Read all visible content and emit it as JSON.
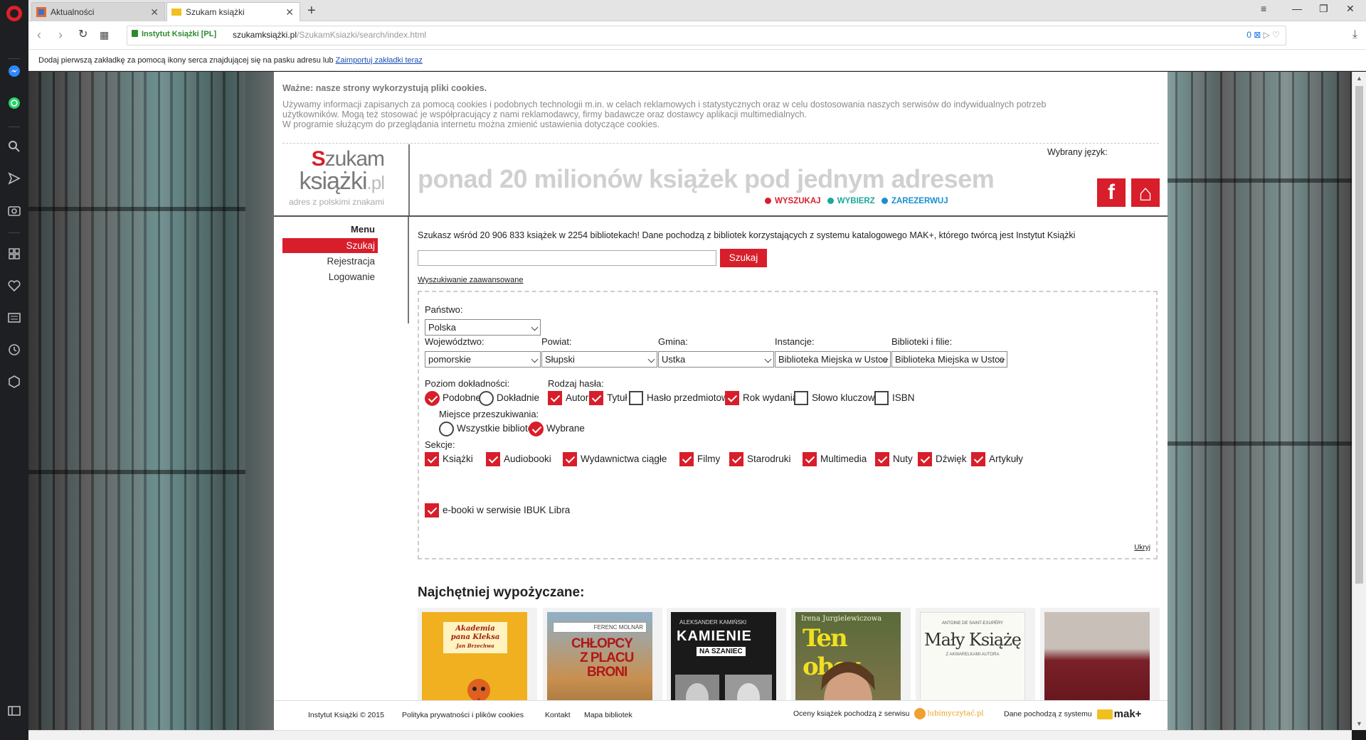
{
  "browser": {
    "tabs": [
      {
        "label": "Aktualności",
        "active": false
      },
      {
        "label": "Szukam książki",
        "active": true
      }
    ],
    "security_label": "Instytut Książki [PL]",
    "url_host": "szukamksiążki.pl",
    "url_path": "/SzukamKsiazki/search/index.html",
    "url_badge": "0",
    "bookmark_notice": "Dodaj pierwszą zakładkę za pomocą ikony serca znajdującej się na pasku adresu lub",
    "bookmark_link": "Zaimportuj zakładki teraz"
  },
  "cookie": {
    "title": "Ważne: nasze strony wykorzystują pliki cookies.",
    "line1": "Używamy informacji zapisanych za pomocą cookies i podobnych technologii m.in. w celach reklamowych i statystycznych oraz w celu dostosowania naszych serwisów do indywidualnych potrzeb",
    "line2": "użytkowników. Mogą też stosować je współpracujący z nami reklamodawcy, firmy badawcze oraz dostawcy aplikacji multimedialnych.",
    "line3": "W programie służącym do przeglądania internetu można zmienić ustawienia dotyczące cookies."
  },
  "header": {
    "logo_line1": "zukam",
    "logo_q": "S",
    "logo_line2": "książki",
    "logo_pl": ".pl",
    "logo_tagline": "adres z polskimi znakami",
    "slogan": "ponad 20 milionów książek pod jednym adresem",
    "steps": [
      {
        "label": "WYSZUKAJ",
        "color": "#d81e2a"
      },
      {
        "label": "WYBIERZ",
        "color": "#1aa89a"
      },
      {
        "label": "ZAREZERWUJ",
        "color": "#1a8fd0"
      }
    ],
    "language_label": "Wybrany język:",
    "facebook_glyph": "f",
    "home_glyph": "⌂"
  },
  "menu": {
    "title": "Menu",
    "items": [
      "Szukaj",
      "Rejestracja",
      "Logowanie"
    ]
  },
  "search": {
    "intro": "Szukasz wśród 20 906 833 książek w 2254 bibliotekach! Dane pochodzą z bibliotek korzystających z systemu katalogowego MAK+, którego twórcą jest Instytut Książki",
    "input_value": "",
    "button": "Szukaj",
    "advanced_link": "Wyszukiwanie zaawansowane"
  },
  "filters": {
    "country_label": "Państwo:",
    "country_value": "Polska",
    "region_labels": [
      "Województwo:",
      "Powiat:",
      "Gmina:",
      "Instancje:",
      "Biblioteki i filie:"
    ],
    "region_values": [
      "pomorskie",
      "Słupski",
      "Ustka",
      "Biblioteka Miejska w Ustce",
      "Biblioteka Miejska w Ustce"
    ],
    "precision_label": "Poziom dokładności:",
    "precision_options": [
      {
        "label": "Podobne",
        "checked": true
      },
      {
        "label": "Dokładnie",
        "checked": false
      }
    ],
    "term_label": "Rodzaj hasła:",
    "term_options": [
      {
        "label": "Autor",
        "checked": true
      },
      {
        "label": "Tytuł",
        "checked": true
      },
      {
        "label": "Hasło przedmiotowe",
        "checked": false
      },
      {
        "label": "Rok wydania",
        "checked": true
      },
      {
        "label": "Słowo kluczowe",
        "checked": false
      },
      {
        "label": "ISBN",
        "checked": false
      }
    ],
    "place_label": "Miejsce przeszukiwania:",
    "place_options": [
      {
        "label": "Wszystkie biblioteki",
        "checked": false
      },
      {
        "label": "Wybrane",
        "checked": true
      }
    ],
    "sections_label": "Sekcje:",
    "sections": [
      {
        "label": "Książki",
        "checked": true
      },
      {
        "label": "Audiobooki",
        "checked": true
      },
      {
        "label": "Wydawnictwa ciągłe",
        "checked": true
      },
      {
        "label": "Filmy",
        "checked": true
      },
      {
        "label": "Starodruki",
        "checked": true
      },
      {
        "label": "Multimedia",
        "checked": true
      },
      {
        "label": "Nuty",
        "checked": true
      },
      {
        "label": "Dźwięk",
        "checked": true
      },
      {
        "label": "Artykuły",
        "checked": true
      }
    ],
    "ebook_option": {
      "label": "e-booki w serwisie IBUK Libra",
      "checked": true
    },
    "hide_link": "Ukryj"
  },
  "popular": {
    "title": "Najchętniej wypożyczane:",
    "covers": [
      {
        "lines": [
          "Akademia",
          "pana Kleksa",
          "Jan Brzechwa"
        ],
        "bg": "#f0b020",
        "fg": "#a02010"
      },
      {
        "lines": [
          "FERENC MOLNÁR",
          "CHŁOPCY",
          "Z PLACU",
          "BRONI"
        ],
        "bg": "#c89050",
        "fg": "#b01818"
      },
      {
        "lines": [
          "ALEKSANDER KAMIŃSKI",
          "KAMIENIE",
          "NA SZANIEC"
        ],
        "bg": "#1a1a1a",
        "fg": "#ffffff"
      },
      {
        "lines": [
          "Irena Jurgielewiczowa",
          "Ten obcy"
        ],
        "bg": "#6a7a40",
        "fg": "#f0e020"
      },
      {
        "lines": [
          "ANTOINE DE SAINT-EXUPÉRY",
          "Mały Książę",
          "Z AKWARELKAMI AUTORA"
        ],
        "bg": "#fafaf5",
        "fg": "#333333"
      },
      {
        "lines": [],
        "bg": "#7a2028",
        "fg": "#ffffff"
      }
    ]
  },
  "footer": {
    "links": [
      "Instytut Książki © 2015",
      "Polityka prywatności i plików cookies",
      "Kontakt",
      "Mapa bibliotek"
    ],
    "ratings_source": "Oceny książek pochodzą z serwisu",
    "ratings_brand": "lubimyczytać.pl",
    "data_source": "Dane pochodzą z systemu",
    "data_brand": "mak+"
  }
}
